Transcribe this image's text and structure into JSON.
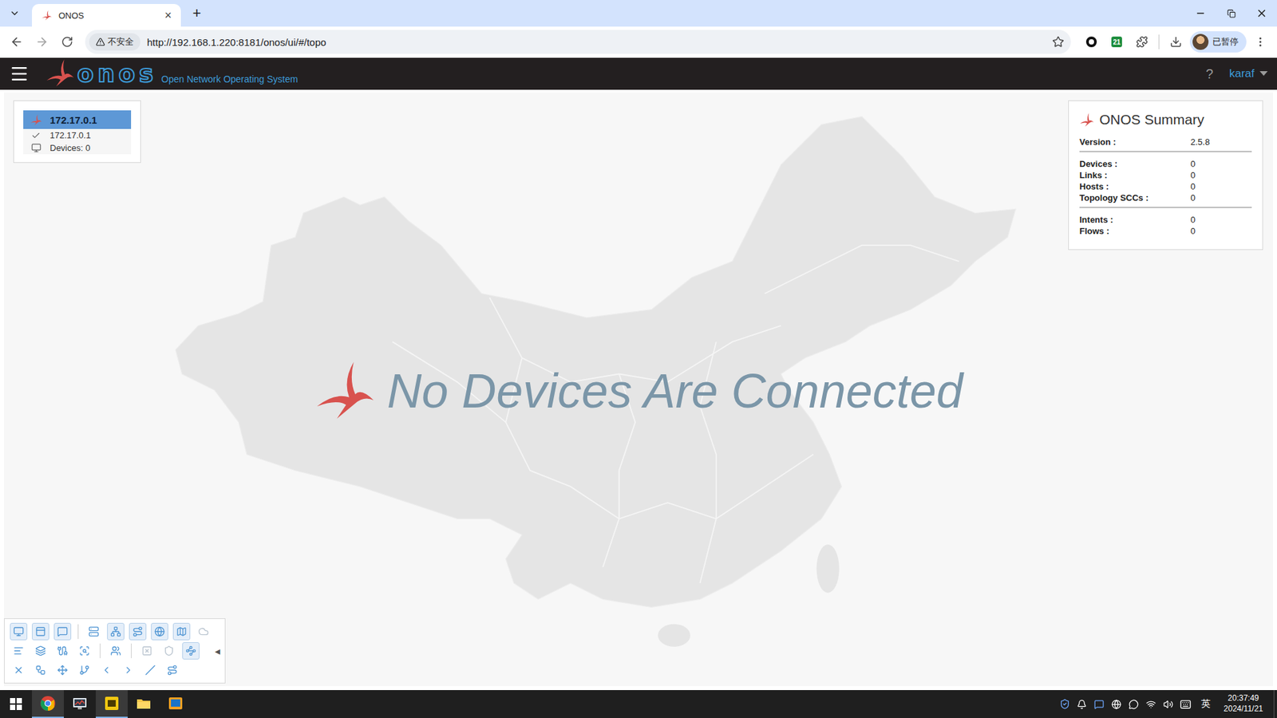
{
  "browser": {
    "tabs": [
      {
        "label": "ONOS",
        "selected": true,
        "close": "×"
      }
    ],
    "new_tab": "+",
    "address": {
      "security": "不安全",
      "url": "http://192.168.1.220:8181/onos/ui/#/topo",
      "bookmarked": false
    },
    "extension_badge": "21",
    "profile": "已暂停"
  },
  "header": {
    "logo": "onos",
    "subtitle": "Open Network Operating System",
    "help": "?",
    "user": "karaf"
  },
  "cluster": {
    "title": "172.17.0.1",
    "nodes": [
      {
        "address": "172.17.0.1",
        "online": true,
        "devices": "Devices: 0"
      }
    ]
  },
  "summary": {
    "title": "ONOS Summary",
    "groups": [
      [
        {
          "label": "Version :",
          "value": "2.5.8"
        }
      ],
      [
        {
          "label": "Devices :",
          "value": "0"
        },
        {
          "label": "Links :",
          "value": "0"
        },
        {
          "label": "Hosts :",
          "value": "0"
        },
        {
          "label": "Topology SCCs :",
          "value": "0"
        }
      ],
      [
        {
          "label": "Intents :",
          "value": "0"
        },
        {
          "label": "Flows :",
          "value": "0"
        }
      ]
    ]
  },
  "message": "No Devices Are Connected",
  "toolbar": {
    "rows": [
      {
        "groups": [
          [
            {
              "selected": true,
              "disabled": false
            },
            {
              "selected": true,
              "disabled": false
            },
            {
              "selected": true,
              "disabled": false
            }
          ],
          [
            {
              "selected": false,
              "disabled": false
            },
            {
              "selected": true,
              "disabled": false
            },
            {
              "selected": true,
              "disabled": false
            },
            {
              "selected": true,
              "disabled": false
            },
            {
              "selected": true,
              "disabled": false
            },
            {
              "selected": false,
              "disabled": true
            }
          ]
        ]
      },
      {
        "groups": [
          [
            {
              "selected": false,
              "disabled": false
            },
            {
              "selected": false,
              "disabled": false
            },
            {
              "selected": false,
              "disabled": false
            },
            {
              "selected": false,
              "disabled": false
            }
          ],
          [
            {
              "selected": false,
              "disabled": false
            }
          ],
          [
            {
              "selected": false,
              "disabled": true
            },
            {
              "selected": false,
              "disabled": true
            },
            {
              "selected": true,
              "disabled": false
            }
          ]
        ]
      },
      {
        "groups": [
          [
            {
              "selected": false,
              "disabled": false
            },
            {
              "selected": false,
              "disabled": false
            },
            {
              "selected": false,
              "disabled": false
            },
            {
              "selected": false,
              "disabled": false
            },
            {
              "selected": false,
              "disabled": false
            },
            {
              "selected": false,
              "disabled": false
            },
            {
              "selected": false,
              "disabled": false
            },
            {
              "selected": false,
              "disabled": false
            }
          ]
        ]
      }
    ],
    "collapse": "◂"
  },
  "taskbar": {
    "apps": [
      {
        "active": true
      },
      {
        "active": false
      },
      {
        "active": true
      },
      {
        "active": false
      },
      {
        "active": false
      }
    ],
    "ime": "英",
    "time": "20:37:49",
    "date": "2024/11/21"
  }
}
